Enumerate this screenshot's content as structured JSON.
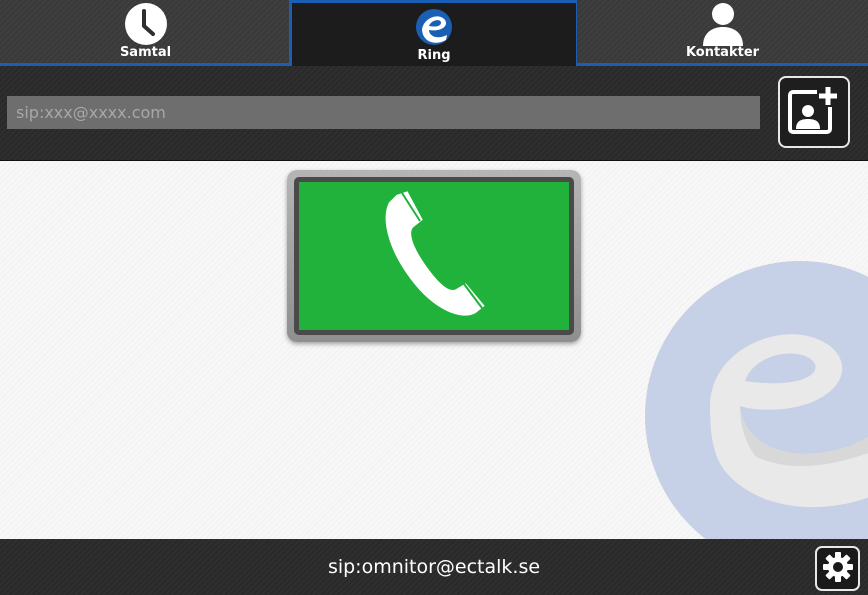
{
  "tabs": [
    {
      "label": "Samtal",
      "icon": "clock-icon",
      "active": false
    },
    {
      "label": "Ring",
      "icon": "ectalk-logo-icon",
      "active": true
    },
    {
      "label": "Kontakter",
      "icon": "person-icon",
      "active": false
    }
  ],
  "dial": {
    "placeholder": "sip:xxx@xxxx.com",
    "value": "",
    "add_contact_icon": "add-contact-icon"
  },
  "call_button": {
    "icon": "phone-handset-icon",
    "color": "#21b23c"
  },
  "status": {
    "account": "sip:omnitor@ectalk.se"
  },
  "settings": {
    "icon": "gear-icon"
  },
  "colors": {
    "accent": "#1a5fb4",
    "call_green": "#21b23c",
    "watermark_blue": "#c6d0e6"
  }
}
